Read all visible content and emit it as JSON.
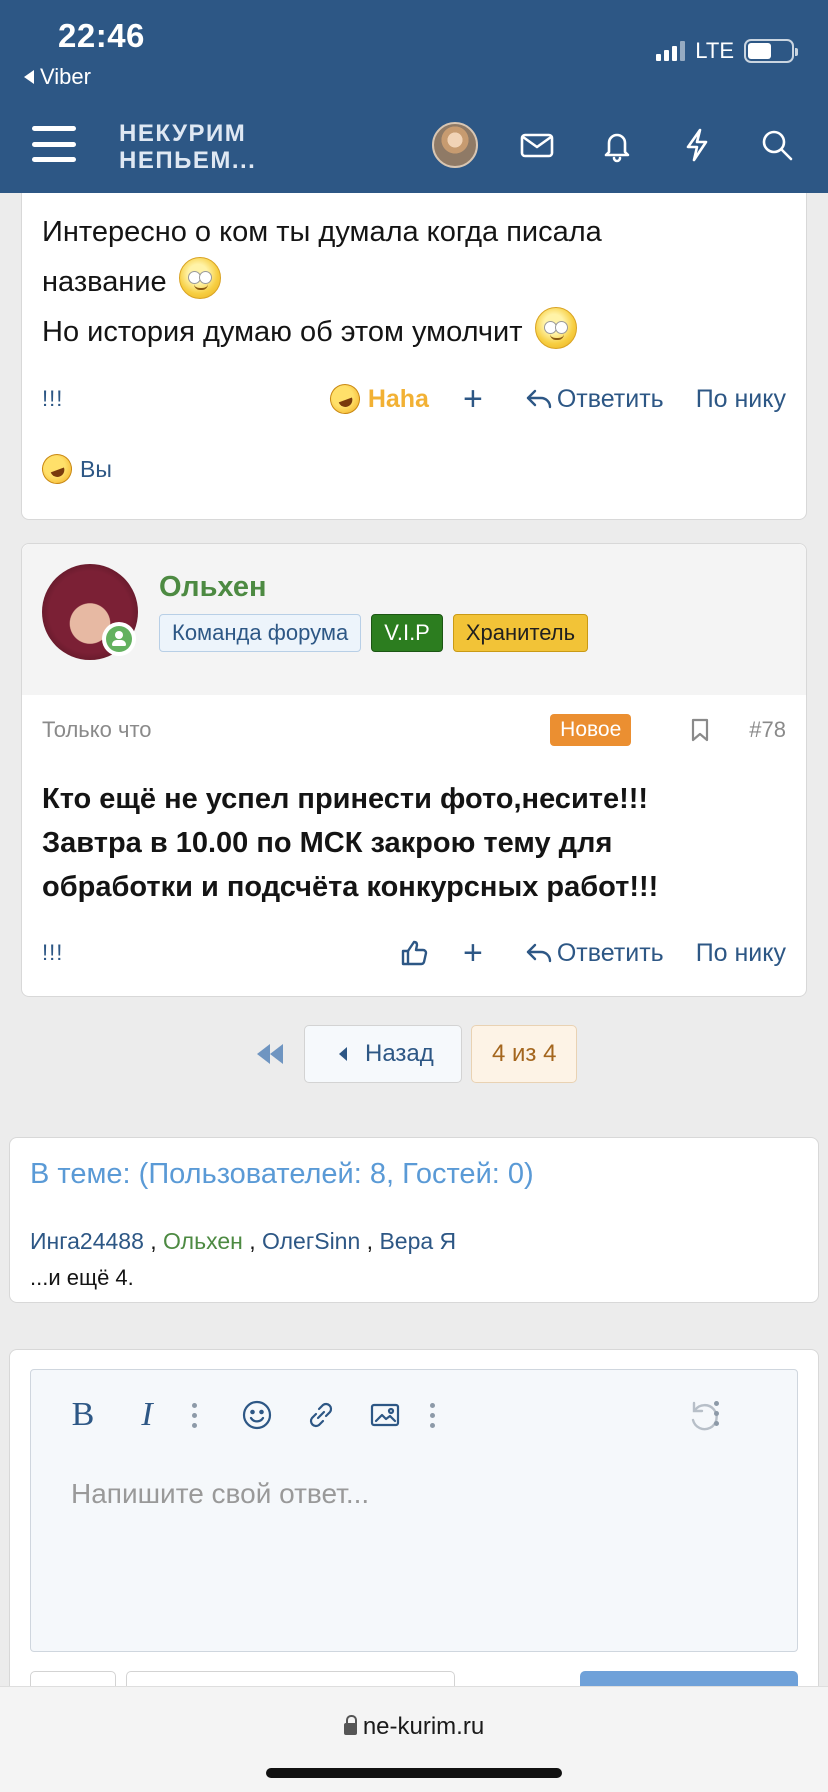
{
  "status_bar": {
    "time": "22:46",
    "back_app": "Viber",
    "network": "LTE"
  },
  "header": {
    "logo_line1": "НЕКУРИМ",
    "logo_line2": "НЕПЬЕМ..."
  },
  "post1": {
    "line1": "Интересно о ком ты думала когда писала",
    "line2": "название",
    "line3": "Но история думаю об этом умолчит",
    "actions": {
      "report": "!!!",
      "reaction": "Haha",
      "plus": "+",
      "reply": "Ответить",
      "quote": "По нику"
    },
    "reacted_by": "Вы"
  },
  "post2": {
    "author": "Ольхен",
    "badges": {
      "team": "Команда форума",
      "vip": "V.I.P",
      "keeper": "Хранитель"
    },
    "time": "Только что",
    "new_label": "Новое",
    "number": "#78",
    "text_line1": "Кто ещё не успел принести фото,несите!!!",
    "text_line2": "Завтра в 10.00 по МСК закрою тему для",
    "text_line3": "обработки и подсчёта конкурсных работ!!!",
    "actions": {
      "report": "!!!",
      "plus": "+",
      "reply": "Ответить",
      "quote": "По нику"
    }
  },
  "pagination": {
    "back": "Назад",
    "current": "4 из 4"
  },
  "online": {
    "title": "В теме: (Пользователей: 8, Гостей: 0)",
    "users": [
      "Инга24488",
      "Ольхен",
      "ОлегSinn",
      "Вера Я"
    ],
    "more": "...и ещё 4."
  },
  "editor": {
    "placeholder": "Напишите свой ответ..."
  },
  "browser": {
    "url": "ne-kurim.ru"
  }
}
